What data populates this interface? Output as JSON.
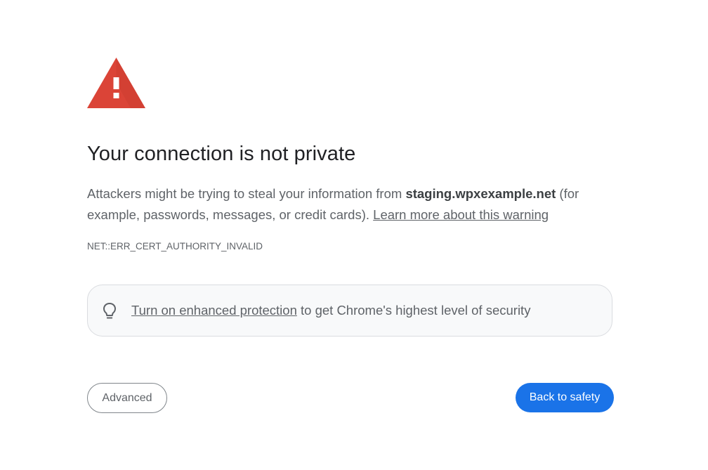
{
  "icons": {
    "warning": "warning-triangle-icon",
    "bulb": "lightbulb-icon"
  },
  "colors": {
    "warning_red": "#db4437",
    "primary_blue": "#1a73e8",
    "text_primary": "#202124",
    "text_secondary": "#5f6368"
  },
  "interstitial": {
    "title": "Your connection is not private",
    "description_before": "Attackers might be trying to steal your information from ",
    "host": "staging.wpxexample.net",
    "description_after": " (for example, passwords, messages, or credit cards). ",
    "learn_more_link": "Learn more about this warning",
    "error_code": "NET::ERR_CERT_AUTHORITY_INVALID"
  },
  "enhanced_protection": {
    "link": "Turn on enhanced protection",
    "text": " to get Chrome's highest level of security"
  },
  "buttons": {
    "advanced": "Advanced",
    "back_to_safety": "Back to safety"
  }
}
